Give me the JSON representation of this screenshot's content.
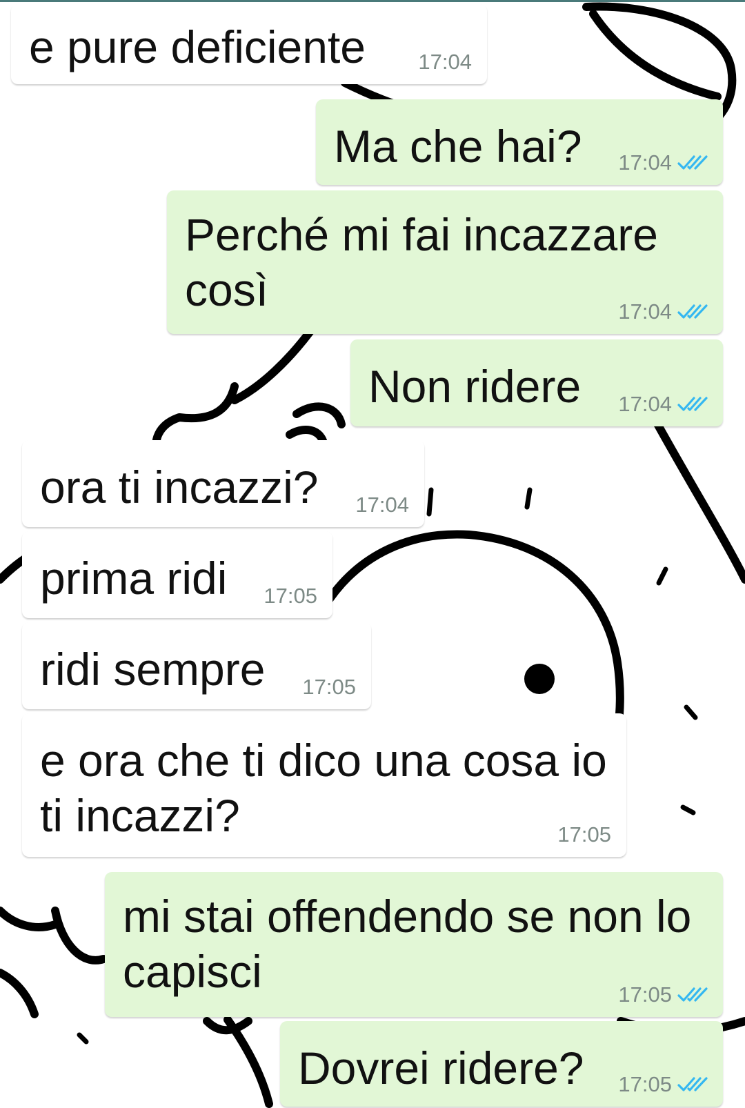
{
  "colors": {
    "incoming_bubble": "#ffffff",
    "outgoing_bubble": "#e2f7d6",
    "timestamp": "#7d8a86",
    "read_ticks": "#34b7f1"
  },
  "messages": [
    {
      "direction": "incoming",
      "text": "e pure deficiente",
      "time": "17:04"
    },
    {
      "direction": "outgoing",
      "text": "Ma che hai?",
      "time": "17:04",
      "status_icon": "double-check-icon"
    },
    {
      "direction": "outgoing",
      "text": "Perché mi fai incazzare così",
      "time": "17:04",
      "status_icon": "double-check-icon"
    },
    {
      "direction": "outgoing",
      "text": "Non ridere",
      "time": "17:04",
      "status_icon": "double-check-icon"
    },
    {
      "direction": "incoming",
      "text": "ora ti incazzi?",
      "time": "17:04"
    },
    {
      "direction": "incoming",
      "text": "prima ridi",
      "time": "17:05"
    },
    {
      "direction": "incoming",
      "text": "ridi sempre",
      "time": "17:05"
    },
    {
      "direction": "incoming",
      "text": "e ora che ti dico una cosa io ti incazzi?",
      "time": "17:05"
    },
    {
      "direction": "outgoing",
      "text": "mi stai offendendo se non lo capisci",
      "time": "17:05",
      "status_icon": "double-check-icon"
    },
    {
      "direction": "outgoing",
      "text": "Dovrei ridere?",
      "time": "17:05",
      "status_icon": "double-check-icon"
    }
  ]
}
